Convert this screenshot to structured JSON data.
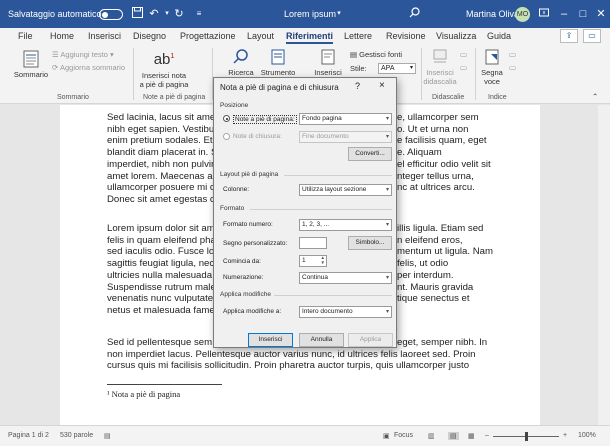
{
  "titlebar": {
    "autosave_label": "Salvataggio automatico",
    "doc_title": "Lorem ipsum",
    "user_name": "Martina Oliva",
    "user_initials": "MO"
  },
  "tabs": [
    "File",
    "Home",
    "Inserisci",
    "Disegno",
    "Progettazione",
    "Layout",
    "Riferimenti",
    "Lettere",
    "Revisione",
    "Visualizza",
    "Guida"
  ],
  "active_tab": "Riferimenti",
  "ribbon": {
    "sommario": "Sommario",
    "aggiungi_testo": "Aggiungi testo",
    "aggiorna_sommario": "Aggiorna sommario",
    "group_sommario": "Sommario",
    "inserisci_nota_line1": "Inserisci nota",
    "inserisci_nota_line2": "a piè di pagina",
    "group_note": "Note a piè di pagina",
    "ricerca": "Ricerca",
    "strumento": "Strumento",
    "inserisci": "Inserisci",
    "gestisci_fonti": "Gestisci fonti",
    "stile_label": "Stile:",
    "stile_value": "APA",
    "inserisci_didascalia_line1": "Inserisci",
    "inserisci_didascalia_line2": "didascalia",
    "group_didascalie": "Didascalie",
    "segna_voce_line1": "Segna",
    "segna_voce_line2": "voce",
    "group_indice": "Indice"
  },
  "document": {
    "para1": [
      "Sed lacinia, lacus sit amet",
      "nibh eget sapien. Vestibu",
      "enim pretium sodales. Et",
      "blandit diam placerat in. S",
      "imperdiet, nibh non pulvir",
      "amet lorem. Maecenas a",
      "ullamcorper posuere mi c",
      "Donec sit amet egestas c"
    ],
    "para1_right": [
      "e, ullamcorper sem",
      "o. Ut et urna non",
      "e facilisis quam, eget",
      "e. Aliquam",
      "el efficitur odio velit sit",
      "nteger tellus urna,",
      "nc at ultrices arcu."
    ],
    "para2": [
      "Lorem ipsum dolor sit am",
      "felis in quam eleifend pha",
      "sed iaculis odio. Fusce lo",
      "sagittis feugiat ligula, nec",
      "ultricies nulla malesuada",
      "Suspendisse rutrum male",
      "venenatis nunc vulputate",
      "netus et malesuada fame"
    ],
    "para2_right": [
      "illis ligula. Etiam sed",
      "n eleifend eros,",
      "mentum ut ligula. Nam",
      "felis, ut odio",
      "per interdum.",
      "nt. Mauris gravida",
      "tique senectus et"
    ],
    "para3": [
      "Sed id pellentesque sem",
      "non imperdiet lacus. Pellentesque auctor varius nunc, id ultrices felis laoreet sed. Proin",
      "cursus quis mi facilisis sollicitudin. Proin pharetra auctor turpis, quis ullamcorper justo"
    ],
    "para3_right": "eget, semper nibh. In",
    "footnote": "¹ Nota a piè di pagina"
  },
  "dialog": {
    "title": "Nota a piè di pagina e di chiusura",
    "help": "?",
    "close": "×",
    "posizione": "Posizione",
    "note_pie_label": "Note a piè di pagina:",
    "note_pie_value": "Fondo pagina",
    "note_chiusura_label": "Note di chiusura:",
    "note_chiusura_value": "Fine documento",
    "converti": "Converti...",
    "layout_section": "Layout piè di pagina",
    "colonne_label": "Colonne:",
    "colonne_value": "Utilizza layout sezione",
    "formato_section": "Formato",
    "formato_numero_label": "Formato numero:",
    "formato_numero_value": "1, 2, 3, ...",
    "segno_label": "Segno personalizzato:",
    "simbolo": "Simbolo...",
    "comincia_label": "Comincia da:",
    "comincia_value": "1",
    "numerazione_label": "Numerazione:",
    "numerazione_value": "Continua",
    "applica_section": "Applica modifiche",
    "applica_label": "Applica modifiche a:",
    "applica_value": "Intero documento",
    "inserisci": "Inserisci",
    "annulla": "Annulla",
    "applica": "Applica"
  },
  "status": {
    "page": "Pagina 1 di 2",
    "words": "530 parole",
    "focus": "Focus",
    "zoom": "100%"
  },
  "colors": {
    "titlebar": "#2b579a",
    "accent": "#0078d7"
  }
}
